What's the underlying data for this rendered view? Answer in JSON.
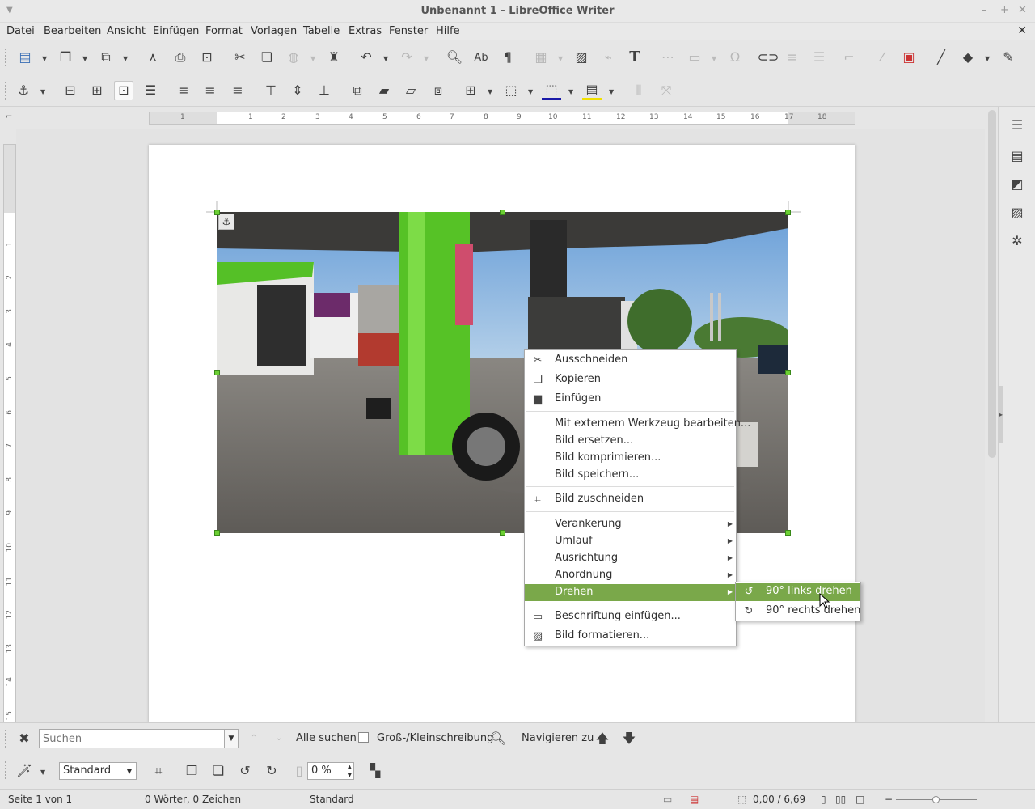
{
  "window": {
    "title": "Unbenannt 1 - LibreOffice Writer",
    "min": "–",
    "max": "+",
    "close": "✕"
  },
  "menubar": [
    "Datei",
    "Bearbeiten",
    "Ansicht",
    "Einfügen",
    "Format",
    "Vorlagen",
    "Tabelle",
    "Extras",
    "Fenster",
    "Hilfe"
  ],
  "ruler": {
    "h_ticks": [
      "1",
      "1",
      "2",
      "3",
      "4",
      "5",
      "6",
      "7",
      "8",
      "9",
      "10",
      "11",
      "12",
      "13",
      "14",
      "15",
      "16",
      "17",
      "18"
    ],
    "v_ticks": [
      "1",
      "2",
      "3",
      "4",
      "5",
      "6",
      "7",
      "8",
      "9",
      "10",
      "11",
      "12",
      "13",
      "14",
      "15"
    ]
  },
  "context_menu": {
    "items": [
      {
        "label": "Ausschneiden",
        "icon": "scissors-icon"
      },
      {
        "label": "Kopieren",
        "icon": "copy-icon"
      },
      {
        "label": "Einfügen",
        "icon": "paste-icon"
      },
      {
        "label": "Mit externem Werkzeug bearbeiten..."
      },
      {
        "label": "Bild ersetzen..."
      },
      {
        "label": "Bild komprimieren..."
      },
      {
        "label": "Bild speichern..."
      },
      {
        "label": "Bild zuschneiden",
        "icon": "crop-icon"
      },
      {
        "label": "Verankerung",
        "submenu": true
      },
      {
        "label": "Umlauf",
        "submenu": true
      },
      {
        "label": "Ausrichtung",
        "submenu": true
      },
      {
        "label": "Anordnung",
        "submenu": true
      },
      {
        "label": "Drehen",
        "submenu": true,
        "highlighted": true
      },
      {
        "label": "Beschriftung einfügen...",
        "icon": "caption-icon"
      },
      {
        "label": "Bild formatieren...",
        "icon": "image-icon"
      }
    ]
  },
  "submenu": {
    "items": [
      {
        "label": "90° links drehen",
        "icon": "rotate-left-icon",
        "highlighted": true
      },
      {
        "label": "90° rechts drehen",
        "icon": "rotate-right-icon"
      }
    ]
  },
  "findbar": {
    "placeholder": "Suchen",
    "find_all": "Alle suchen",
    "match_case": "Groß-/Kleinschreibung",
    "navigate": "Navigieren zu"
  },
  "imagebar": {
    "graphics_mode": "Standard",
    "transparency": "0 %"
  },
  "statusbar": {
    "page": "Seite 1 von 1",
    "words": "0 Wörter, 0 Zeichen",
    "style": "Standard",
    "position": "0,00 / 6,69"
  },
  "colors": {
    "accent": "#7aa84a",
    "handle": "#6ccf33"
  }
}
